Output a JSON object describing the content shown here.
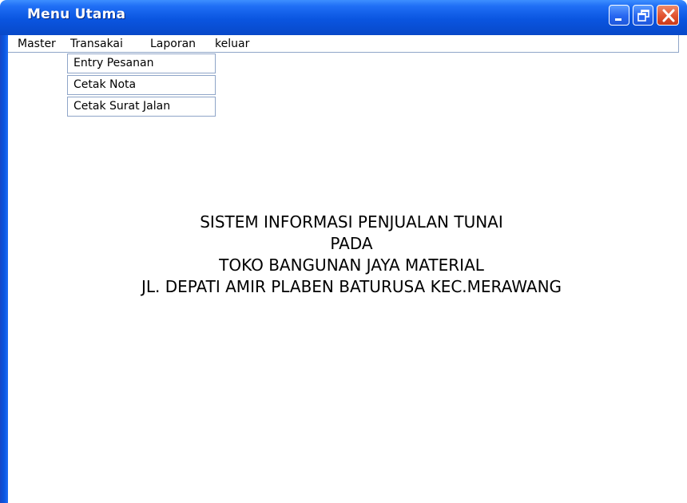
{
  "window": {
    "title": "Menu Utama"
  },
  "menubar": {
    "items": [
      {
        "label": "Master"
      },
      {
        "label": "Transakai"
      },
      {
        "label": "Laporan"
      },
      {
        "label": "keluar"
      }
    ]
  },
  "dropdown": {
    "items": [
      {
        "label": "Entry Pesanan"
      },
      {
        "label": "Cetak Nota"
      },
      {
        "label": "Cetak Surat Jalan"
      }
    ]
  },
  "main": {
    "lines": [
      "SISTEM INFORMASI PENJUALAN TUNAI",
      "PADA",
      "TOKO BANGUNAN JAYA MATERIAL",
      "JL. DEPATI AMIR PLABEN BATURUSA KEC.MERAWANG"
    ]
  },
  "colors": {
    "titlebar": "#0a55e0",
    "close_button": "#e2532f",
    "menu_border": "#8fa5c8"
  },
  "icons": {
    "minimize": "minimize-icon",
    "maximize": "restore-icon",
    "close": "close-icon"
  }
}
